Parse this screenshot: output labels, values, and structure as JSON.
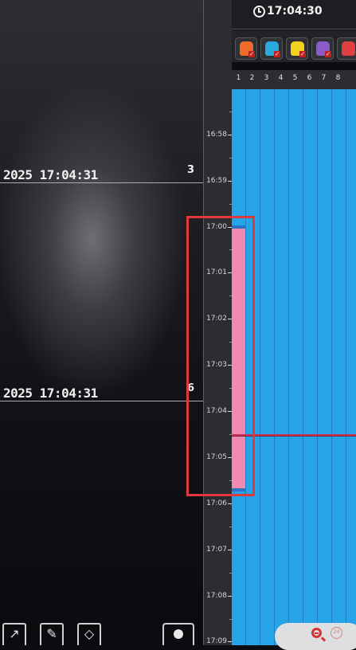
{
  "header": {
    "clock_time": "17:04:30"
  },
  "cameras": [
    {
      "timestamp": "2025 17:04:31",
      "number": "3"
    },
    {
      "timestamp": "2025 17:04:31",
      "number": "6"
    }
  ],
  "event_types": [
    {
      "name": "person-icon",
      "color": "#3bb54a"
    },
    {
      "name": "vehicle-icon",
      "color": "#f06a2a"
    },
    {
      "name": "face-icon",
      "color": "#2aa8e0"
    },
    {
      "name": "motion-icon",
      "color": "#f2d21c"
    },
    {
      "name": "object-icon",
      "color": "#8b5cc9"
    },
    {
      "name": "tripwire-icon",
      "color": "#e04040"
    }
  ],
  "channels": [
    "1",
    "2",
    "3",
    "4",
    "5",
    "6",
    "7",
    "8"
  ],
  "timeline": {
    "tick_labels": [
      "16:58",
      "16:59",
      "17:00",
      "17:01",
      "17:02",
      "17:03",
      "17:04",
      "17:05",
      "17:06",
      "17:07",
      "17:08",
      "17:09"
    ]
  },
  "colors": {
    "grid": "#27a3e8",
    "event": "#f08ab0",
    "highlight": "#e0393d",
    "cursor": "#cc3355"
  }
}
